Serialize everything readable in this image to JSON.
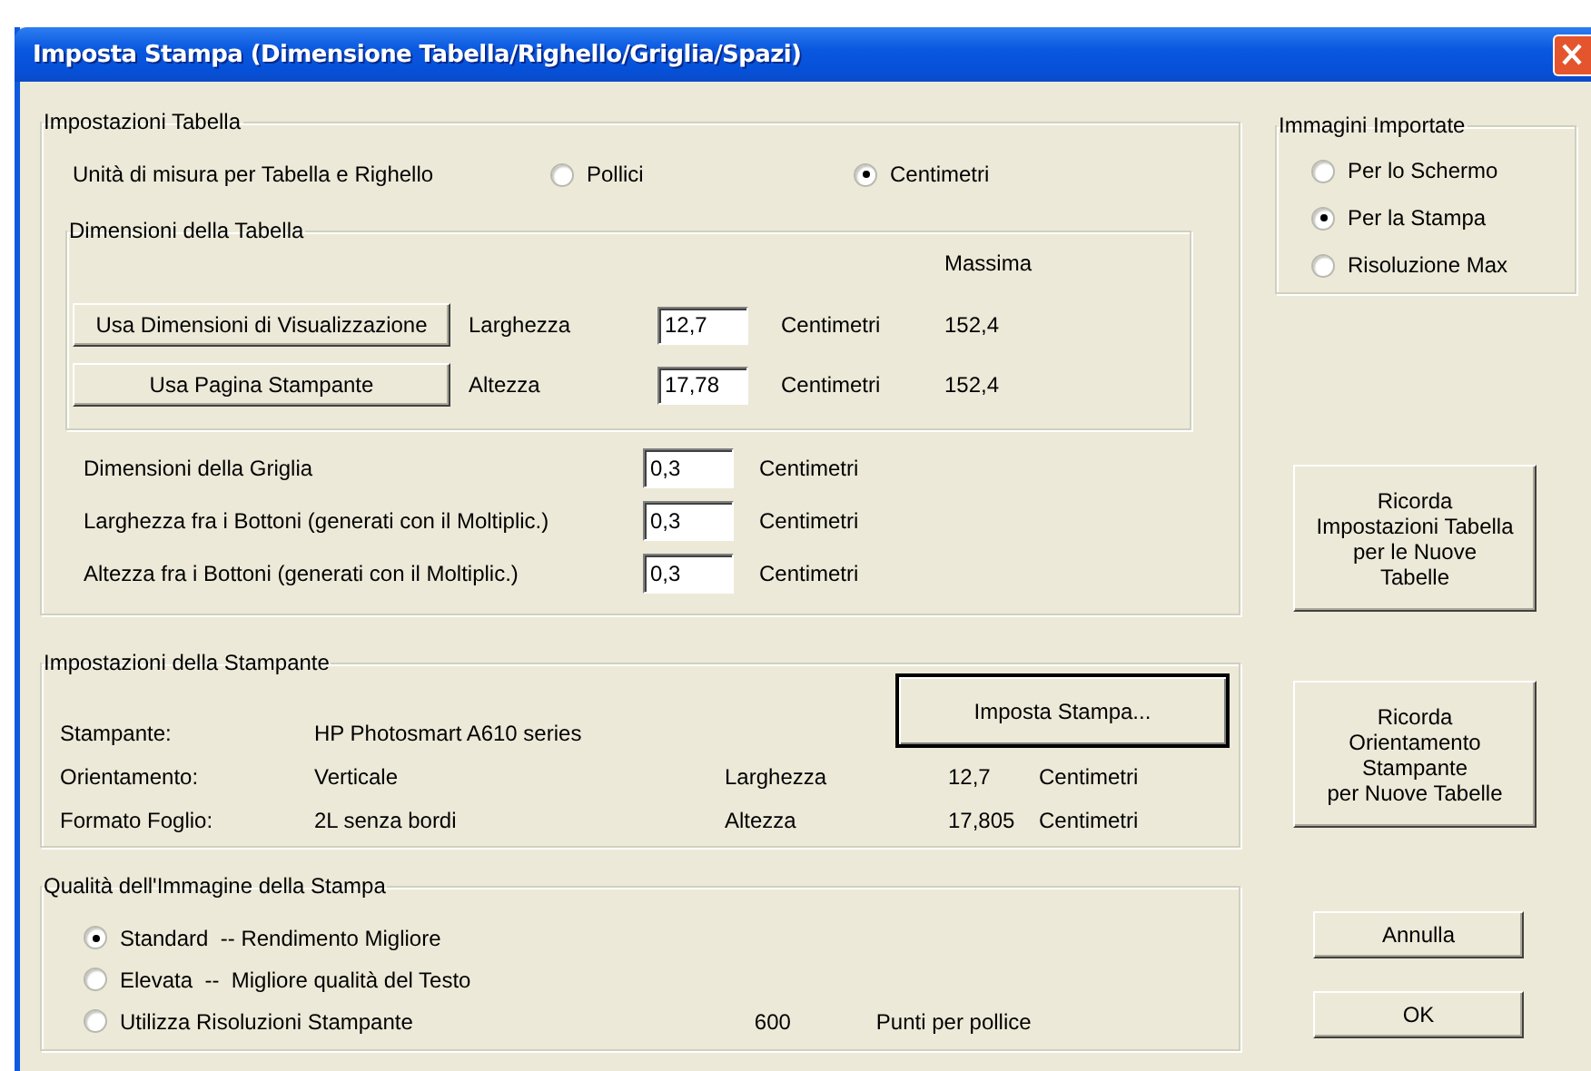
{
  "window": {
    "title": "Imposta Stampa (Dimensione Tabella/Righello/Griglia/Spazi)"
  },
  "table_settings": {
    "title": "Impostazioni Tabella",
    "unit_label": "Unità di misura per Tabella e Righello",
    "unit_options": [
      {
        "label": "Pollici",
        "selected": false
      },
      {
        "label": "Centimetri",
        "selected": true
      }
    ],
    "dimensions": {
      "title": "Dimensioni della Tabella",
      "max_header": "Massima",
      "rows": [
        {
          "button": "Usa Dimensioni di Visualizzazione",
          "label": "Larghezza",
          "value": "12,7",
          "unit": "Centimetri",
          "max": "152,4"
        },
        {
          "button": "Usa Pagina Stampante",
          "label": "Altezza",
          "value": "17,78",
          "unit": "Centimetri",
          "max": "152,4"
        }
      ]
    },
    "spacing_rows": [
      {
        "label": "Dimensioni della Griglia",
        "value": "0,3",
        "unit": "Centimetri"
      },
      {
        "label": "Larghezza fra i Bottoni (generati con il Moltiplic.)",
        "value": "0,3",
        "unit": "Centimetri"
      },
      {
        "label": "Altezza fra i Bottoni (generati con il Moltiplic.)",
        "value": "0,3",
        "unit": "Centimetri"
      }
    ]
  },
  "imported_images": {
    "title": "Immagini Importate",
    "options": [
      {
        "label": "Per lo Schermo",
        "selected": false
      },
      {
        "label": "Per la Stampa",
        "selected": true
      },
      {
        "label": "Risoluzione Max",
        "selected": false
      }
    ]
  },
  "remember_table_button": "Ricorda\nImpostazioni Tabella\nper le Nuove\nTabelle",
  "printer_settings": {
    "title": "Impostazioni della Stampante",
    "setup_button": "Imposta Stampa...",
    "rows": [
      {
        "label": "Stampante:",
        "value": "HP Photosmart A610 series"
      },
      {
        "label": "Orientamento:",
        "value": "Verticale",
        "dim_label": "Larghezza",
        "dim_value": "12,7",
        "dim_unit": "Centimetri"
      },
      {
        "label": "Formato Foglio:",
        "value": "2L senza bordi",
        "dim_label": "Altezza",
        "dim_value": "17,805",
        "dim_unit": "Centimetri"
      }
    ]
  },
  "remember_orientation_button": "Ricorda\nOrientamento\nStampante\nper Nuove Tabelle",
  "print_quality": {
    "title": "Qualità dell'Immagine della Stampa",
    "options": [
      {
        "label": "Standard  -- Rendimento Migliore",
        "selected": true
      },
      {
        "label": "Elevata  --  Migliore qualità del Testo",
        "selected": false
      },
      {
        "label": "Utilizza Risoluzioni Stampante",
        "selected": false
      }
    ],
    "resolution": "600",
    "resolution_unit": "Punti per pollice"
  },
  "buttons": [
    "Annulla",
    "OK"
  ]
}
